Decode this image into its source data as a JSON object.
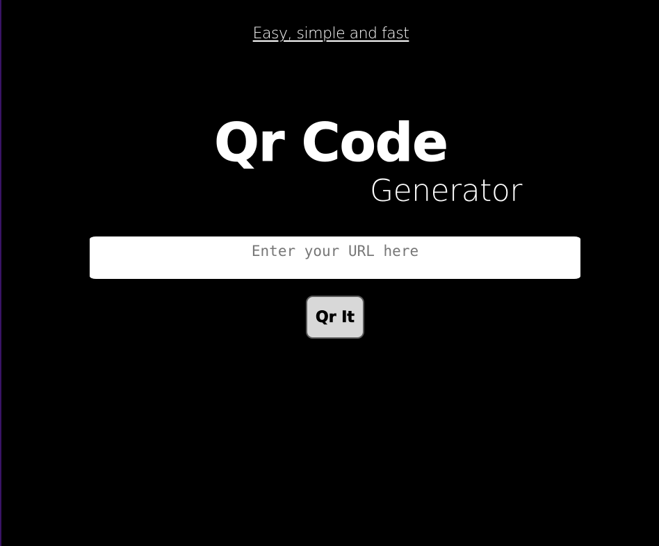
{
  "header": {
    "tagline": "Easy, simple and fast"
  },
  "hero": {
    "title": "Qr Code",
    "subtitle": "Generator"
  },
  "form": {
    "url_input": {
      "value": "",
      "placeholder": "Enter your URL here"
    },
    "submit_label": "Qr It"
  },
  "colors": {
    "background": "#000000",
    "text": "#ffffff",
    "input_background": "#ffffff",
    "button_background": "#d8d8d8"
  }
}
